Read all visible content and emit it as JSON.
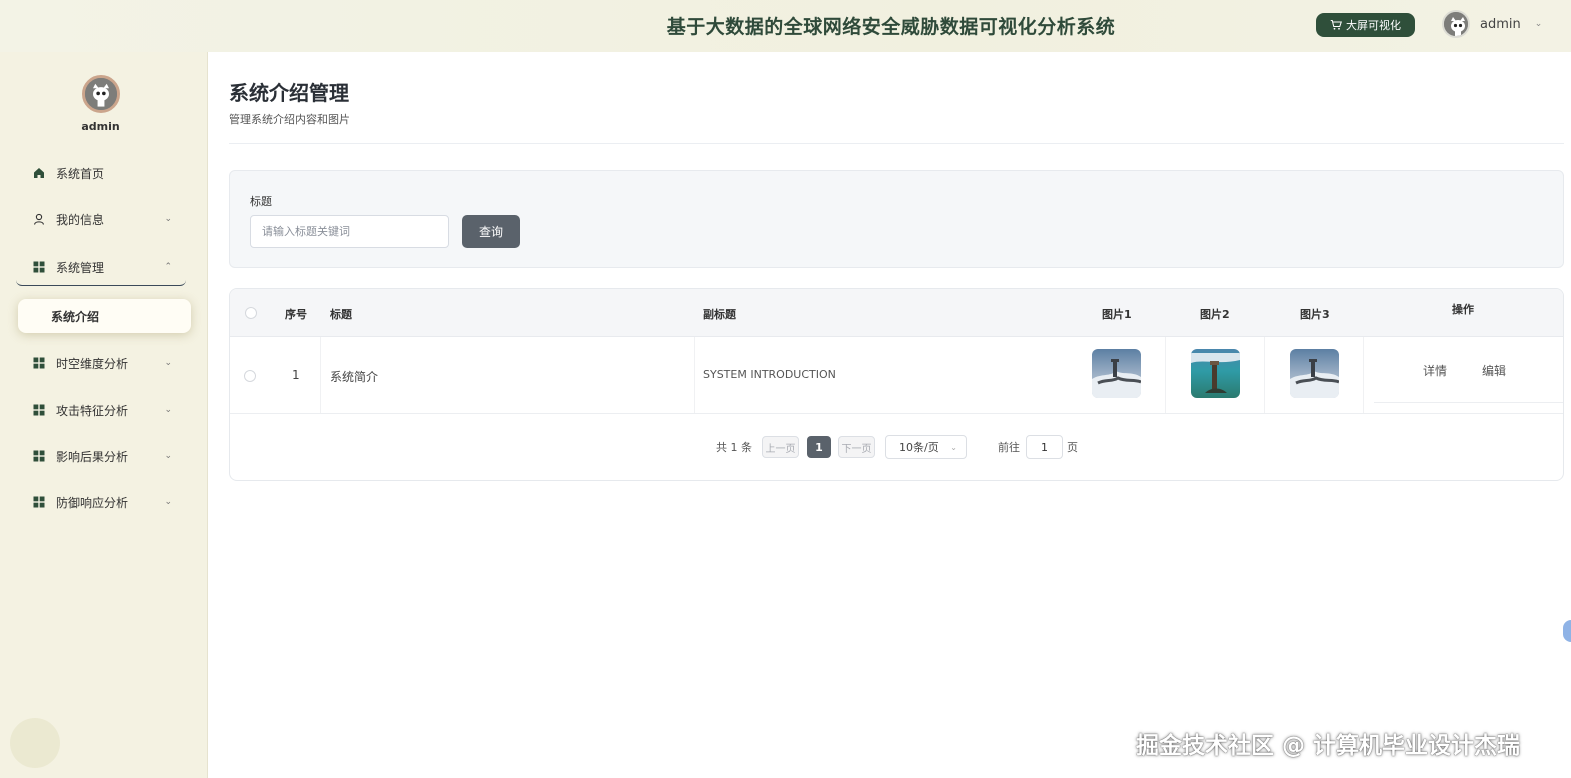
{
  "header": {
    "title": "基于大数据的全球网络安全威胁数据可视化分析系统",
    "bigscreen_label": "大屏可视化",
    "username": "admin"
  },
  "sidebar": {
    "username": "admin",
    "items": [
      {
        "label": "系统首页",
        "icon": "home-icon"
      },
      {
        "label": "我的信息",
        "icon": "user-icon"
      },
      {
        "label": "系统管理",
        "icon": "grid-icon"
      },
      {
        "label": "时空维度分析",
        "icon": "grid-icon"
      },
      {
        "label": "攻击特征分析",
        "icon": "grid-icon"
      },
      {
        "label": "影响后果分析",
        "icon": "grid-icon"
      },
      {
        "label": "防御响应分析",
        "icon": "grid-icon"
      }
    ],
    "active_sub": "系统介绍"
  },
  "page": {
    "title": "系统介绍管理",
    "subtitle": "管理系统介绍内容和图片"
  },
  "search": {
    "label": "标题",
    "placeholder": "请输入标题关键词",
    "button": "查询"
  },
  "table": {
    "columns": [
      "序号",
      "标题",
      "副标题",
      "图片1",
      "图片2",
      "图片3",
      "操作"
    ],
    "rows": [
      {
        "index": "1",
        "title": "系统简介",
        "subtitle": "SYSTEM INTRODUCTION",
        "detail": "详情",
        "edit": "编辑"
      }
    ]
  },
  "pagination": {
    "total": "共 1 条",
    "prev": "上一页",
    "current": "1",
    "next": "下一页",
    "page_size": "10条/页",
    "goto_label": "前往",
    "goto_value": "1",
    "page_suffix": "页"
  },
  "watermark": "掘金技术社区 @ 计算机毕业设计杰瑞",
  "colors": {
    "accent": "#2f4f3a",
    "sidebar_bg": "#f4f2e2",
    "button_gray": "#5a626b"
  }
}
